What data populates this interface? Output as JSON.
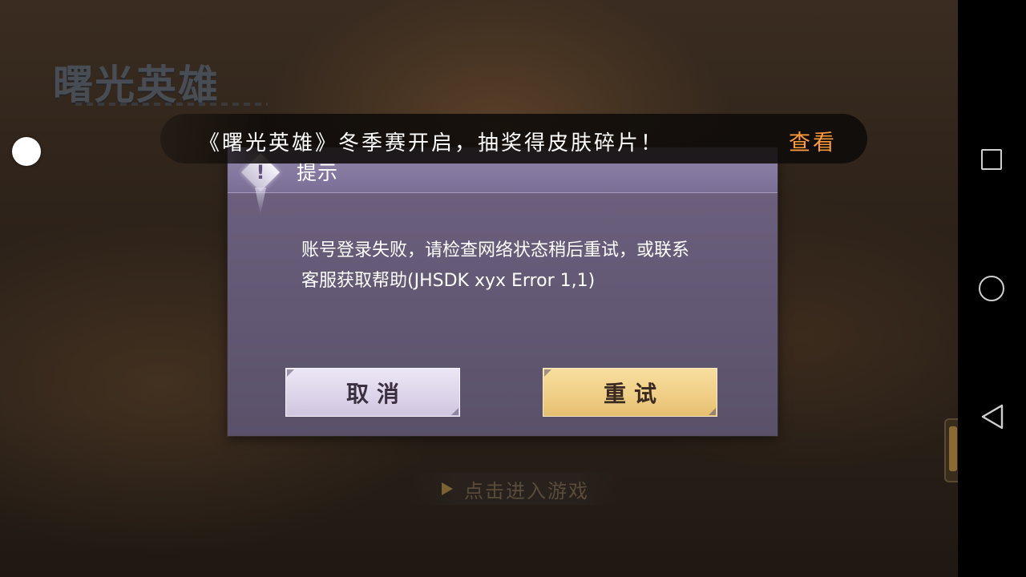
{
  "game": {
    "logo": "曙光英雄",
    "enter_label": "点击进入游戏"
  },
  "banner": {
    "text": "《曙光英雄》冬季赛开启，抽奖得皮肤碎片！",
    "link": "查看"
  },
  "dialog": {
    "title": "提示",
    "icon": "warning-icon",
    "message_line1": "账号登录失败，请检查网络状态稍后重试，或联系",
    "message_line2": "客服获取帮助(JHSDK xyx Error 1,1)",
    "cancel_label": "取消",
    "retry_label": "重试"
  },
  "navbar": {
    "recents_icon": "square-icon",
    "home_icon": "circle-icon",
    "back_icon": "triangle-back-icon"
  },
  "colors": {
    "banner_link": "#ff9b3a",
    "dialog_bg": "#635975",
    "dialog_header": "#8478a0",
    "cancel_button": "#ddd5ea",
    "retry_button": "#f0cf86"
  }
}
